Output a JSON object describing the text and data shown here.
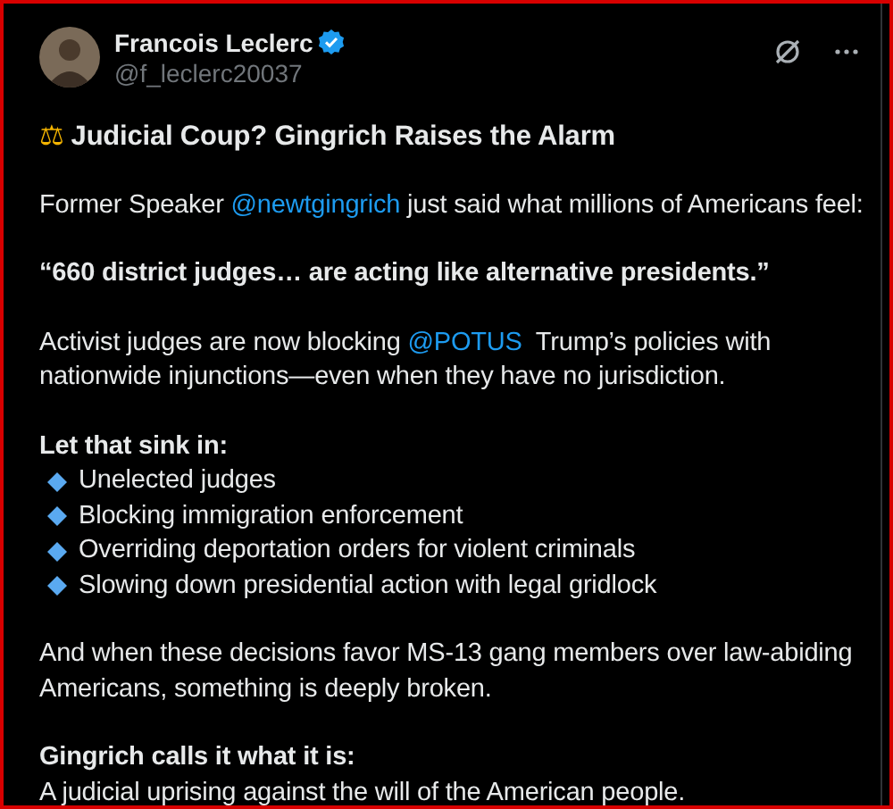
{
  "author": {
    "name": "Francois Leclerc",
    "handle": "@f_leclerc20037",
    "verified": true
  },
  "title": {
    "emoji": "⚖",
    "text": "Judicial Coup? Gingrich Raises the Alarm"
  },
  "blocks": [
    {
      "kind": "paragraph",
      "segments": [
        {
          "kind": "text",
          "text": "Former Speaker "
        },
        {
          "kind": "mention",
          "text": "@newtgingrich"
        },
        {
          "kind": "text",
          "text": " just said what millions of Americans feel:"
        }
      ]
    },
    {
      "kind": "quote",
      "text": "“660 district judges… are acting like alternative presidents.”"
    },
    {
      "kind": "paragraph",
      "segments": [
        {
          "kind": "text",
          "text": "Activist judges are now blocking "
        },
        {
          "kind": "mention",
          "text": "@POTUS"
        },
        {
          "kind": "text",
          "text": "  Trump’s policies with nationwide injunctions—even when they have no jurisdiction."
        }
      ]
    },
    {
      "kind": "list",
      "heading": "Let that sink in:",
      "items": [
        "Unelected judges",
        "Blocking immigration enforcement",
        "Overriding deportation orders for violent criminals",
        "Slowing down presidential action with legal gridlock"
      ]
    },
    {
      "kind": "paragraph",
      "segments": [
        {
          "kind": "text",
          "text": "And when these decisions favor MS-13 gang members over law-abiding Americans, something is deeply broken."
        }
      ]
    },
    {
      "kind": "note",
      "heading": "Gingrich calls it what it is:",
      "text": "A judicial uprising against the will of the American people."
    }
  ]
}
